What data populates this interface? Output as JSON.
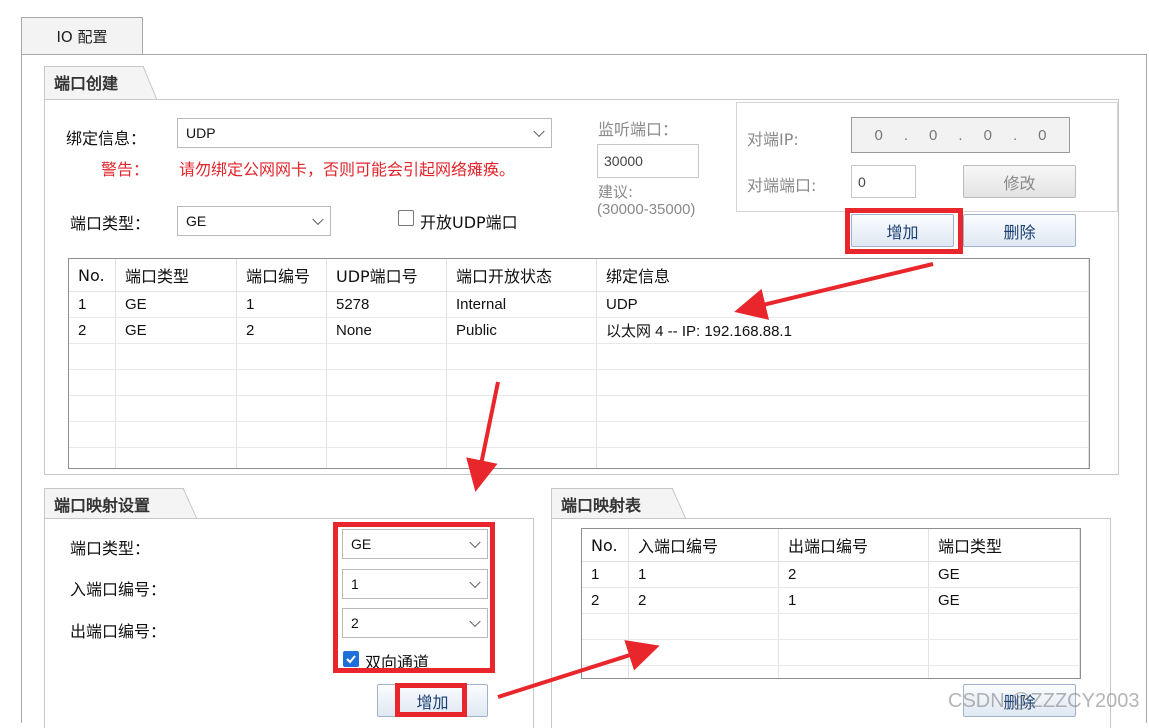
{
  "window_tab": "IO 配置",
  "port_create": {
    "title": "端口创建",
    "bind_label": "绑定信息：",
    "bind_value": "UDP",
    "warning_label": "警告：",
    "warning_text": "请勿绑定公网网卡，否则可能会引起网络瘫痪。",
    "port_type_label": "端口类型：",
    "port_type_value": "GE",
    "open_udp_label": "开放UDP端口",
    "listen_label": "监听端口：",
    "listen_value": "30000",
    "suggest_label": "建议:",
    "suggest_range": "(30000-35000)",
    "peer_ip_label": "对端IP:",
    "peer_ip_octets": [
      "0",
      "0",
      "0",
      "0"
    ],
    "peer_port_label": "对端端口:",
    "peer_port_value": "0",
    "modify_button": "修改",
    "add_button": "增加",
    "delete_button": "删除",
    "table": {
      "columns": [
        "No.",
        "端口类型",
        "端口编号",
        "UDP端口号",
        "端口开放状态",
        "绑定信息"
      ],
      "rows": [
        [
          "1",
          "GE",
          "1",
          "5278",
          "Internal",
          "UDP"
        ],
        [
          "2",
          "GE",
          "2",
          "None",
          "Public",
          "以太网 4 -- IP: 192.168.88.1"
        ]
      ]
    }
  },
  "port_mapping_settings": {
    "title": "端口映射设置",
    "port_type_label": "端口类型：",
    "port_type_value": "GE",
    "in_port_label": "入端口编号：",
    "in_port_value": "1",
    "out_port_label": "出端口编号：",
    "out_port_value": "2",
    "bidirectional_label": "双向通道",
    "add_button": "增加"
  },
  "port_mapping_table": {
    "title": "端口映射表",
    "columns": [
      "No.",
      "入端口编号",
      "出端口编号",
      "端口类型"
    ],
    "rows": [
      [
        "1",
        "1",
        "2",
        "GE"
      ],
      [
        "2",
        "2",
        "1",
        "GE"
      ]
    ],
    "delete_button": "删除"
  },
  "watermark": "CSDN @ZZZCY2003",
  "colors": {
    "highlight": "#e8262b",
    "arrow": "#e8262b",
    "warning_text": "#e0262b",
    "checkbox_checked": "#1e6fd8"
  }
}
